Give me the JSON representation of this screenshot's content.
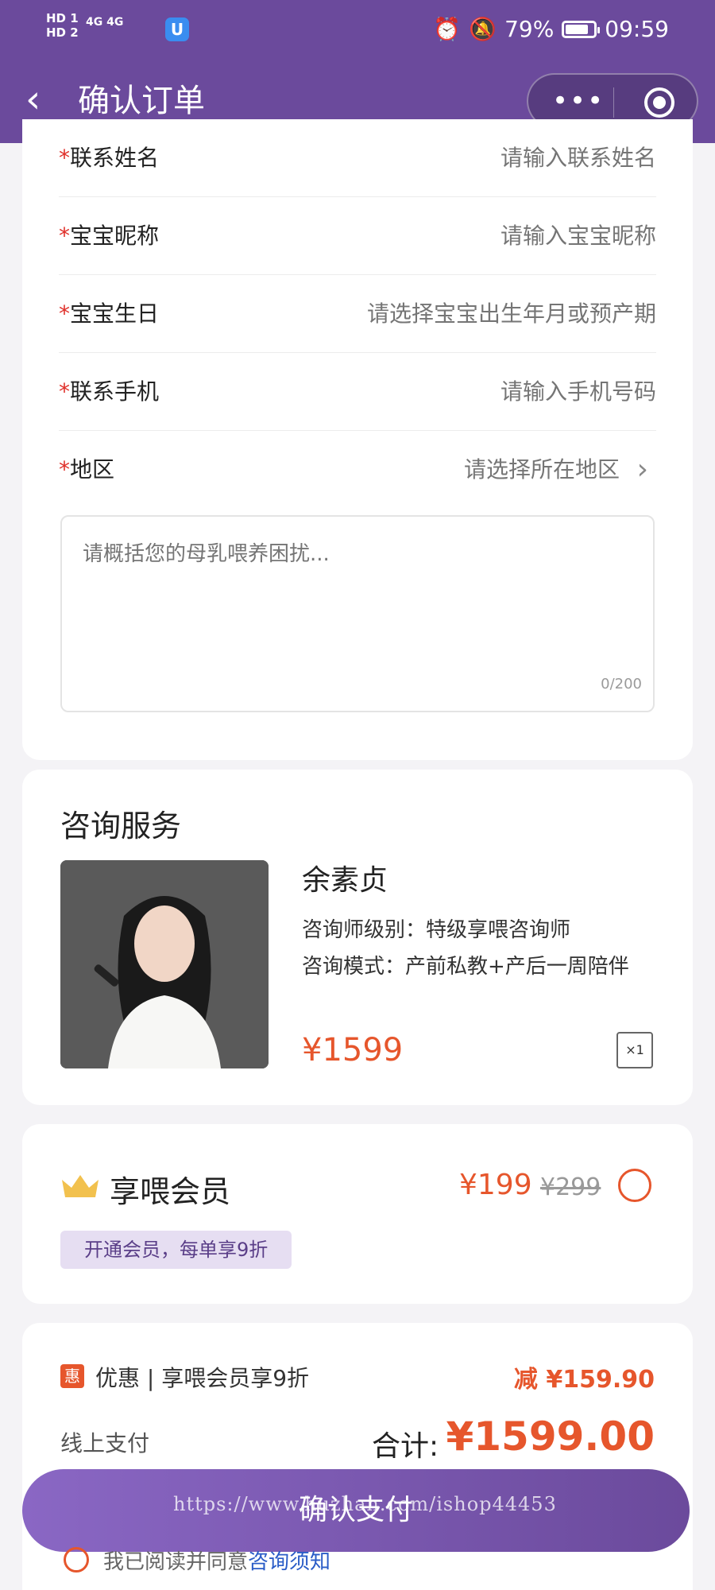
{
  "status_bar": {
    "sim_labels": "HD 1\nHD 2",
    "network": "4G 4G",
    "app_badge": "U",
    "battery": "79%",
    "time": "09:59"
  },
  "nav": {
    "title": "确认订单",
    "menu_dots": "•••"
  },
  "form": {
    "required_mark": "*",
    "fields": [
      {
        "label": "联系姓名",
        "placeholder": "请输入联系姓名"
      },
      {
        "label": "宝宝昵称",
        "placeholder": "请输入宝宝昵称"
      },
      {
        "label": "宝宝生日",
        "placeholder": "请选择宝宝出生年月或预产期"
      },
      {
        "label": "联系手机",
        "placeholder": "请输入手机号码"
      },
      {
        "label": "地区",
        "placeholder": "请选择所在地区"
      }
    ],
    "textarea_placeholder": "请概括您的母乳喂养困扰...",
    "char_count": "0/200"
  },
  "service": {
    "title": "咨询服务",
    "consultant_name": "余素贞",
    "level": "咨询师级别：特级享喂咨询师",
    "mode": "咨询模式：产前私教+产后一周陪伴",
    "price": "¥1599",
    "quantity": "×1"
  },
  "membership": {
    "title": "享喂会员",
    "price": "¥199",
    "original_price": "¥299",
    "badge": "开通会员，每单享9折"
  },
  "payment": {
    "discount_tag": "惠",
    "discount_text": "优惠 | 享喂会员享9折",
    "discount_amount": "减 ¥159.90",
    "method": "线上支付",
    "total_label": "合计:",
    "total_amount": "¥1599.00",
    "confirm_label": "确认支付",
    "agree_text": "我已阅读并同意",
    "agree_link": "咨询须知"
  },
  "watermark": "https://www.huzhan.com/ishop44453",
  "colors": {
    "brand_purple": "#6b4a9c",
    "accent_orange": "#e6562c",
    "required_red": "#e0302a"
  }
}
